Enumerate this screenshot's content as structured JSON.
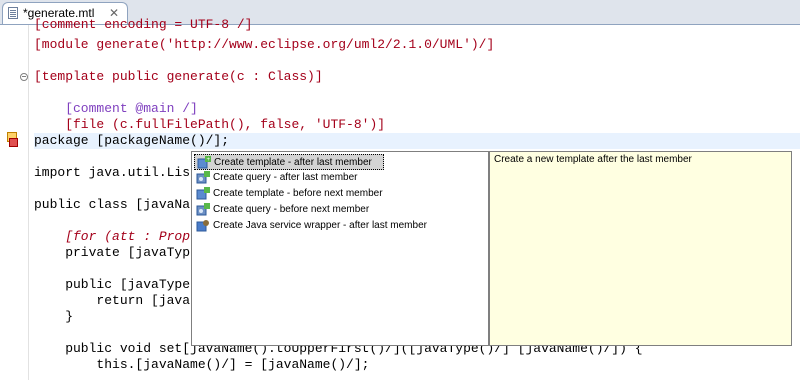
{
  "tab": {
    "title": "*generate.mtl",
    "close": "✕"
  },
  "code": [
    "[comment encoding = UTF-8 /]",
    "[module generate('http://www.eclipse.org/uml2/2.1.0/UML')/]",
    "",
    "[template public generate(c : Class)]",
    "",
    "    [comment @main /]",
    "    [file (c.fullFilePath(), false, 'UTF-8')]",
    "package [packageName()/];",
    "",
    "import java.util.Lis",
    "",
    "public class [javaNa",
    "",
    "    [for (att : Prop",
    "    private [javaTyp",
    "",
    "    public [javaType",
    "        return [java",
    "    }",
    "",
    "    public void set[javaName().toUpperFirst()/]([javaType()/] [javaName()/]) {",
    "        this.[javaName()/] = [javaName()/];"
  ],
  "completion": {
    "items": [
      {
        "label": "Create template - after last member",
        "icon": "template-after-icon"
      },
      {
        "label": "Create query - after last member",
        "icon": "query-after-icon"
      },
      {
        "label": "Create template - before next member",
        "icon": "template-before-icon"
      },
      {
        "label": "Create query - before next member",
        "icon": "query-before-icon"
      },
      {
        "label": "Create Java service wrapper - after last member",
        "icon": "java-wrapper-icon"
      }
    ],
    "selected_index": 0,
    "description": "Create a new template after the last member"
  }
}
